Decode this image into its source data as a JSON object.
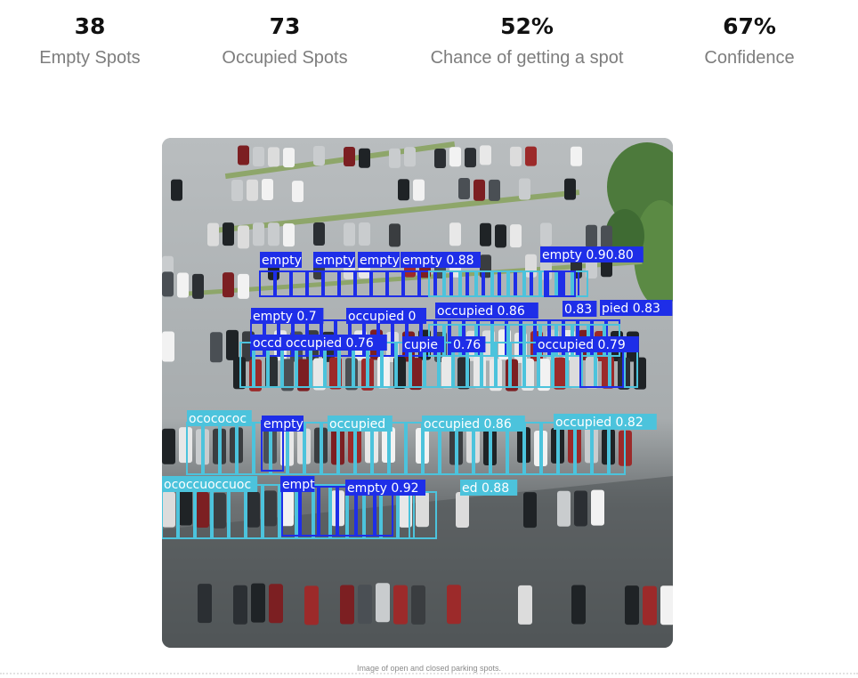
{
  "stats": [
    {
      "value": "38",
      "label": "Empty Spots"
    },
    {
      "value": "73",
      "label": "Occupied Spots"
    },
    {
      "value": "52%",
      "label": "Chance of getting a spot"
    },
    {
      "value": "67%",
      "label": "Confidence"
    }
  ],
  "image": {
    "caption": "Image of open and closed parking spots."
  },
  "detections": {
    "colors": {
      "empty": "#1e2ee8",
      "occupied": "#4cc3dc"
    },
    "labels": [
      "empty",
      "empty",
      "empty",
      "empty 0.88",
      "empty 0.90.80",
      "empty 0.7",
      "occupied 0",
      "occupied 0.86",
      "0.83",
      "pied 0.83",
      "occd",
      "occupied 0.76",
      "cupie",
      "0.76",
      "occupied 0.79",
      "ococococ",
      "empty",
      "occupied",
      "occupied 0.86",
      "occupied 0.82",
      "ococcuoccuoc",
      "empt",
      "empty 0.92",
      "ed 0.88"
    ]
  }
}
